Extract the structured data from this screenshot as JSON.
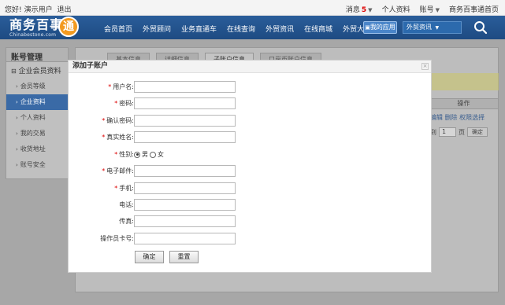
{
  "topbar": {
    "greeting": "您好!",
    "user": "演示用户",
    "logout": "退出",
    "messages_label": "消息",
    "messages_count": "5",
    "profile": "个人资料",
    "account": "账号",
    "site_link": "商务百事通首页"
  },
  "header": {
    "logo_cn": "商务百事",
    "logo_en": "Chinabestone.com",
    "logo_badge": "通",
    "nav": [
      "会员首页",
      "外贸顾问",
      "业务直通车",
      "在线查询",
      "外贸资讯",
      "在线商城",
      "外贸大讲堂"
    ],
    "my_app": "我的应用",
    "search_select": "外贸资讯"
  },
  "sidebar": {
    "title": "账号管理",
    "group": "企业会员资料",
    "items": [
      "会员等级",
      "企业资料",
      "个人资料",
      "我的交易",
      "收货地址",
      "账号安全"
    ]
  },
  "content": {
    "tabs": [
      "基本信息",
      "详细信息",
      "子账户信息",
      "口岸币账户信息"
    ],
    "col_header": "操作",
    "ops": "编辑 删除 权限选择",
    "pager_prefix": "到",
    "pager_value": "1",
    "pager_suffix": "页",
    "pager_go": "确定"
  },
  "modal": {
    "title": "添加子账户",
    "close": "×",
    "fields": {
      "username": {
        "label": "用户名:",
        "required": true,
        "value": ""
      },
      "password": {
        "label": "密码:",
        "required": true,
        "value": ""
      },
      "confirm_password": {
        "label": "确认密码:",
        "required": true,
        "value": ""
      },
      "real_name": {
        "label": "真实姓名:",
        "required": true,
        "value": ""
      },
      "gender": {
        "label": "性别:",
        "required": true,
        "options": [
          "男",
          "女"
        ],
        "selected": "男"
      },
      "email": {
        "label": "电子邮件:",
        "required": true,
        "value": ""
      },
      "mobile": {
        "label": "手机:",
        "required": true,
        "value": ""
      },
      "phone": {
        "label": "电话:",
        "required": false,
        "value": ""
      },
      "fax": {
        "label": "传真:",
        "required": false,
        "value": ""
      },
      "operator_card": {
        "label": "操作员卡号:",
        "required": false,
        "value": ""
      }
    },
    "confirm_button": "确定",
    "reset_button": "重置"
  },
  "colors": {
    "header_blue": "#1e4b82",
    "accent_orange": "#f39a1f",
    "required_red": "#dd0000",
    "sidebar_active": "#3a6aa6"
  }
}
